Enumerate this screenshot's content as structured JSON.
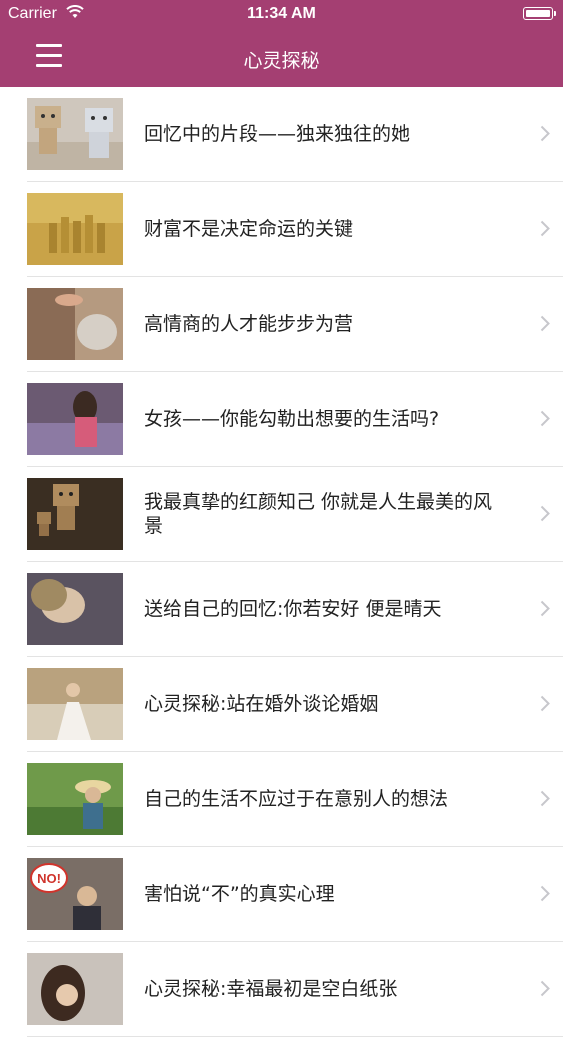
{
  "status_bar": {
    "carrier": "Carrier",
    "time": "11:34 AM"
  },
  "nav": {
    "title": "心灵探秘"
  },
  "colors": {
    "nav_background": "#a43f72",
    "chevron": "#c7c7cc"
  },
  "articles": [
    {
      "title": "回忆中的片段——独来独往的她"
    },
    {
      "title": "财富不是决定命运的关键"
    },
    {
      "title": "高情商的人才能步步为营"
    },
    {
      "title": "女孩——你能勾勒出想要的生活吗?"
    },
    {
      "title": "我最真挚的红颜知己 你就是人生最美的风景"
    },
    {
      "title": "送给自己的回忆:你若安好 便是晴天"
    },
    {
      "title": "心灵探秘:站在婚外谈论婚姻"
    },
    {
      "title": "自己的生活不应过于在意别人的想法"
    },
    {
      "title": "害怕说“不”的真实心理"
    },
    {
      "title": "心灵探秘:幸福最初是空白纸张"
    }
  ],
  "thumb_text": {
    "no_sign": "NO!"
  }
}
